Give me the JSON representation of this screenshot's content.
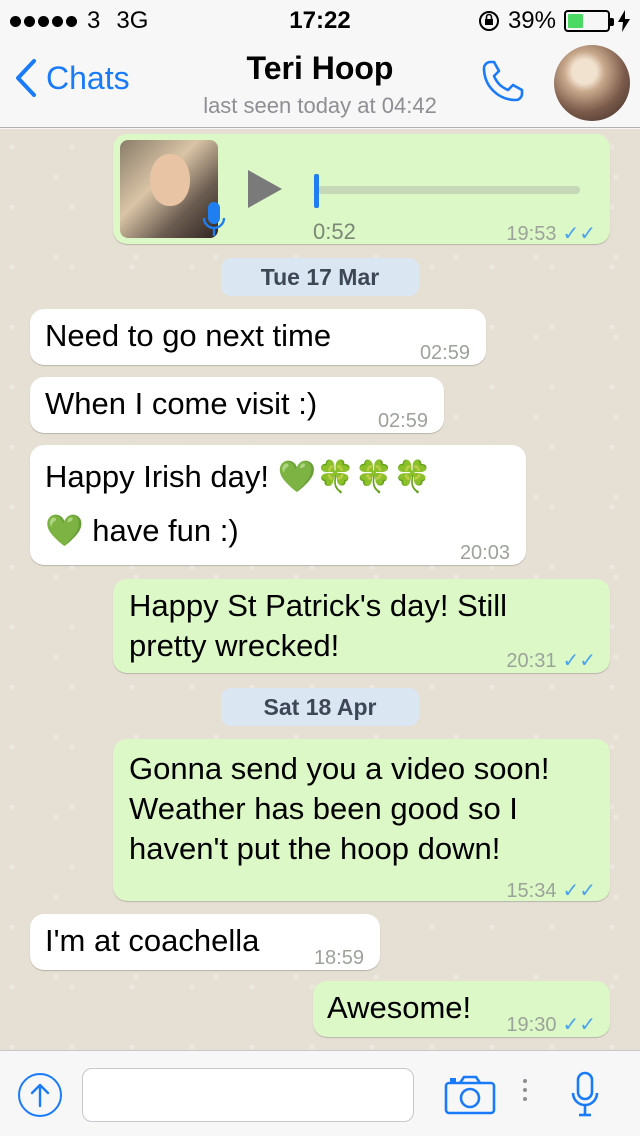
{
  "status_bar": {
    "carrier": "3",
    "network": "3G",
    "time": "17:22",
    "battery_percent": "39%"
  },
  "header": {
    "back_label": "Chats",
    "contact_name": "Teri Hoop",
    "last_seen": "last seen today at 04:42"
  },
  "voice_message": {
    "duration": "0:52",
    "time": "19:53",
    "status": "✓✓"
  },
  "messages": [
    {
      "type": "date",
      "text": "Tue 17 Mar"
    },
    {
      "type": "in",
      "text": "Need to go next time",
      "time": "02:59"
    },
    {
      "type": "in",
      "text": "When I come visit :)",
      "time": "02:59"
    },
    {
      "type": "in",
      "text_line1": "Happy Irish day! 💚🍀🍀🍀",
      "text_line2": "💚 have fun :)",
      "time": "20:03"
    },
    {
      "type": "out",
      "text_line1": "Happy St Patrick's day! Still",
      "text_line2": "pretty wrecked!",
      "time": "20:31",
      "status": "✓✓"
    },
    {
      "type": "date",
      "text": "Sat 18 Apr"
    },
    {
      "type": "out",
      "text_line1": "Gonna send you a video soon!",
      "text_line2": "Weather has been good so I",
      "text_line3": "haven't put the hoop down!",
      "time": "15:34",
      "status": "✓✓"
    },
    {
      "type": "in",
      "text": "I'm at coachella",
      "time": "18:59"
    },
    {
      "type": "out",
      "text": "Awesome!",
      "time": "19:30",
      "status": "✓✓"
    }
  ],
  "input": {
    "placeholder": ""
  },
  "colors": {
    "accent": "#1a7bfa",
    "outgoing_bubble": "#dcf8c6",
    "incoming_bubble": "#ffffff",
    "read_check": "#4aa3f0"
  }
}
